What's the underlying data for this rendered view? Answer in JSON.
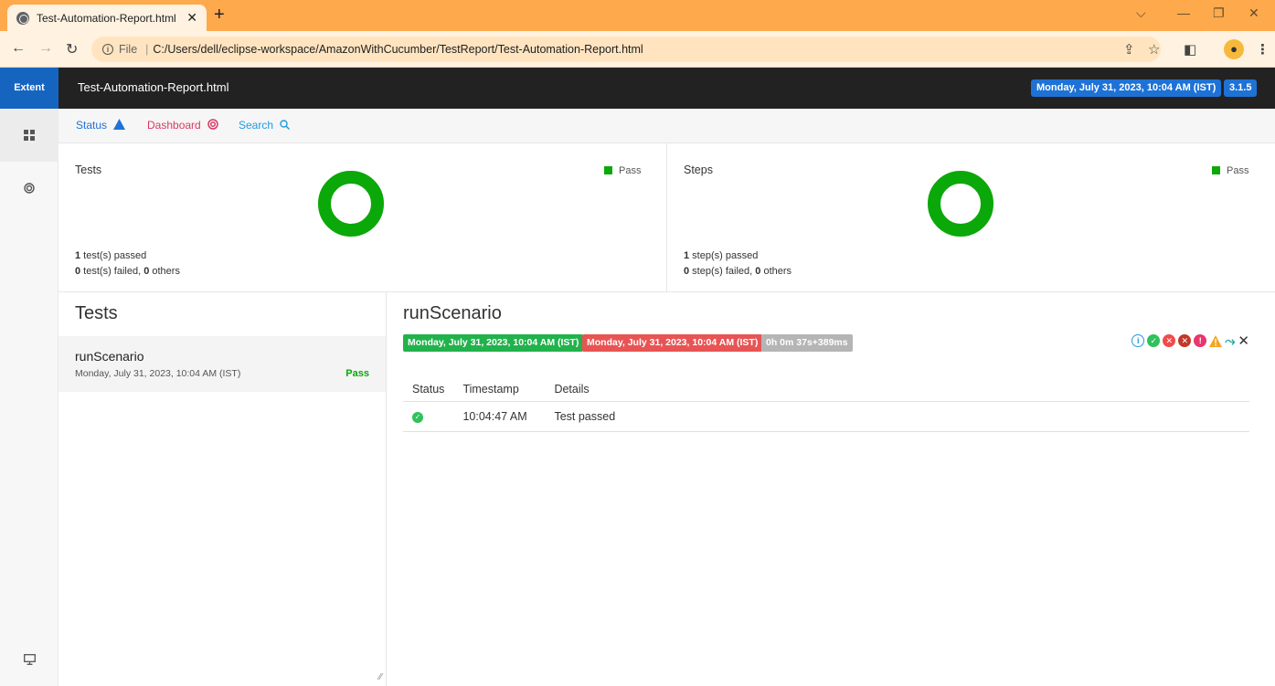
{
  "browser": {
    "tab_title": "Test-Automation-Report.html",
    "tab_close": "✕",
    "new_tab": "+",
    "address_scheme": "File",
    "address_path": "C:/Users/dell/eclipse-workspace/AmazonWithCucumber/TestReport/Test-Automation-Report.html",
    "window_controls": {
      "dropdown": "⌵",
      "minimize": "—",
      "restore": "❐",
      "close": "✕"
    }
  },
  "sidenav": {
    "brand": "Extent",
    "items": [
      {
        "icon": "dashboard-grid-icon"
      },
      {
        "icon": "target-icon"
      },
      {
        "icon": "monitor-icon"
      }
    ]
  },
  "topbar": {
    "report_name": "Test-Automation-Report.html",
    "datetime": "Monday, July 31, 2023, 10:04 AM (IST)",
    "version": "3.1.5"
  },
  "subnav": {
    "status": "Status",
    "dashboard": "Dashboard",
    "search": "Search"
  },
  "summary": {
    "tests": {
      "title": "Tests",
      "legend": "Pass",
      "passed_count": "1",
      "passed_text": " test(s) passed",
      "failed_count": "0",
      "failed_text": " test(s) failed, ",
      "others_count": "0",
      "others_text": " others",
      "pass_fraction": 1.0
    },
    "steps": {
      "title": "Steps",
      "legend": "Pass",
      "passed_count": "1",
      "passed_text": " step(s) passed",
      "failed_count": "0",
      "failed_text": " step(s) failed, ",
      "others_count": "0",
      "others_text": " others",
      "pass_fraction": 1.0
    },
    "pass_color": "#0ba809"
  },
  "test_list": {
    "heading": "Tests",
    "items": [
      {
        "name": "runScenario",
        "time": "Monday, July 31, 2023, 10:04 AM (IST)",
        "status": "Pass"
      }
    ]
  },
  "detail": {
    "title": "runScenario",
    "start_time": "Monday, July 31, 2023, 10:04 AM (IST)",
    "end_time": "Monday, July 31, 2023, 10:04 AM (IST)",
    "duration": "0h 0m 37s+389ms",
    "colors": {
      "start": "#22b24c",
      "end": "#e85454",
      "duration": "#b5b5b5"
    },
    "table": {
      "headers": [
        "Status",
        "Timestamp",
        "Details"
      ],
      "rows": [
        {
          "status": "pass",
          "timestamp": "10:04:47 AM",
          "details": "Test passed"
        }
      ]
    }
  }
}
